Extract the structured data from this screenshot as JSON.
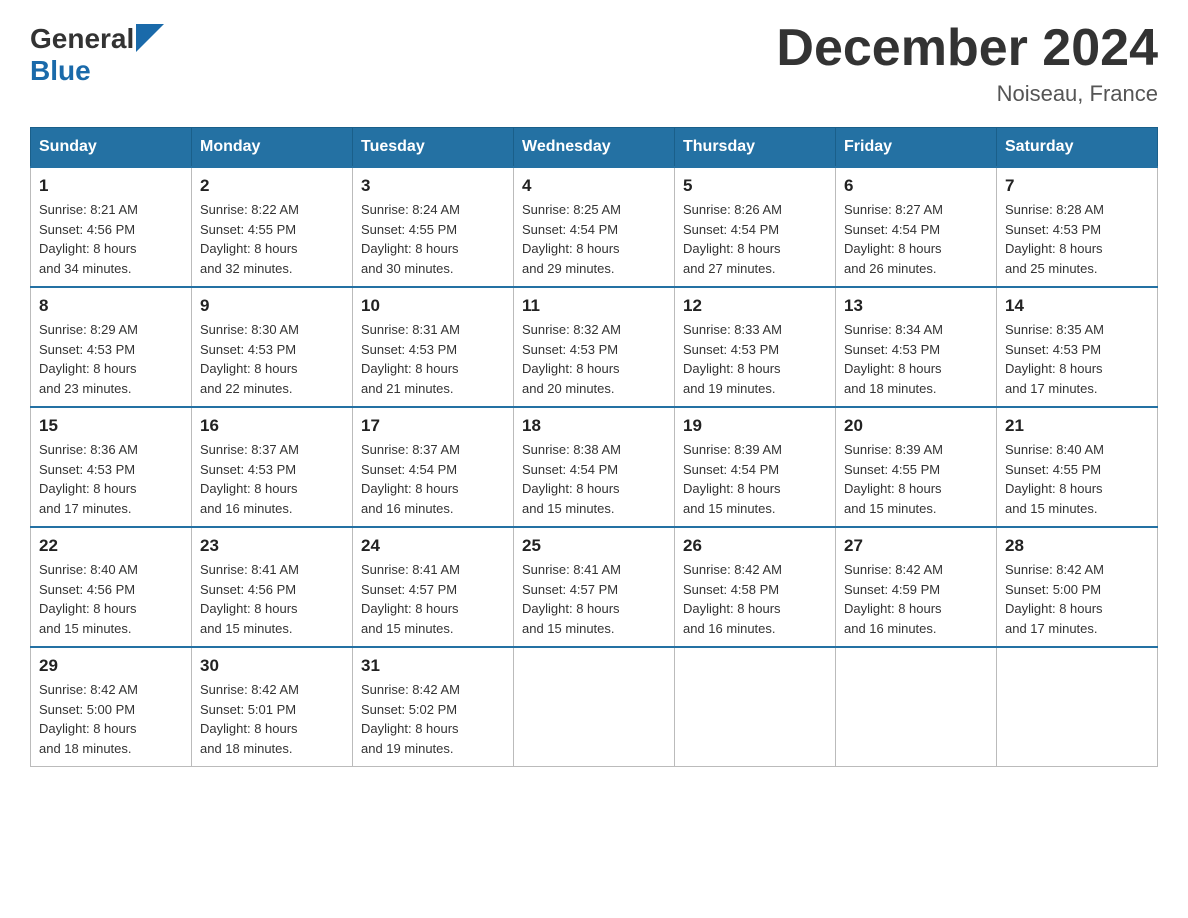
{
  "header": {
    "logo_general": "General",
    "logo_blue": "Blue",
    "title": "December 2024",
    "subtitle": "Noiseau, France"
  },
  "days_of_week": [
    "Sunday",
    "Monday",
    "Tuesday",
    "Wednesday",
    "Thursday",
    "Friday",
    "Saturday"
  ],
  "weeks": [
    [
      {
        "day": "1",
        "sunrise": "8:21 AM",
        "sunset": "4:56 PM",
        "daylight": "8 hours and 34 minutes."
      },
      {
        "day": "2",
        "sunrise": "8:22 AM",
        "sunset": "4:55 PM",
        "daylight": "8 hours and 32 minutes."
      },
      {
        "day": "3",
        "sunrise": "8:24 AM",
        "sunset": "4:55 PM",
        "daylight": "8 hours and 30 minutes."
      },
      {
        "day": "4",
        "sunrise": "8:25 AM",
        "sunset": "4:54 PM",
        "daylight": "8 hours and 29 minutes."
      },
      {
        "day": "5",
        "sunrise": "8:26 AM",
        "sunset": "4:54 PM",
        "daylight": "8 hours and 27 minutes."
      },
      {
        "day": "6",
        "sunrise": "8:27 AM",
        "sunset": "4:54 PM",
        "daylight": "8 hours and 26 minutes."
      },
      {
        "day": "7",
        "sunrise": "8:28 AM",
        "sunset": "4:53 PM",
        "daylight": "8 hours and 25 minutes."
      }
    ],
    [
      {
        "day": "8",
        "sunrise": "8:29 AM",
        "sunset": "4:53 PM",
        "daylight": "8 hours and 23 minutes."
      },
      {
        "day": "9",
        "sunrise": "8:30 AM",
        "sunset": "4:53 PM",
        "daylight": "8 hours and 22 minutes."
      },
      {
        "day": "10",
        "sunrise": "8:31 AM",
        "sunset": "4:53 PM",
        "daylight": "8 hours and 21 minutes."
      },
      {
        "day": "11",
        "sunrise": "8:32 AM",
        "sunset": "4:53 PM",
        "daylight": "8 hours and 20 minutes."
      },
      {
        "day": "12",
        "sunrise": "8:33 AM",
        "sunset": "4:53 PM",
        "daylight": "8 hours and 19 minutes."
      },
      {
        "day": "13",
        "sunrise": "8:34 AM",
        "sunset": "4:53 PM",
        "daylight": "8 hours and 18 minutes."
      },
      {
        "day": "14",
        "sunrise": "8:35 AM",
        "sunset": "4:53 PM",
        "daylight": "8 hours and 17 minutes."
      }
    ],
    [
      {
        "day": "15",
        "sunrise": "8:36 AM",
        "sunset": "4:53 PM",
        "daylight": "8 hours and 17 minutes."
      },
      {
        "day": "16",
        "sunrise": "8:37 AM",
        "sunset": "4:53 PM",
        "daylight": "8 hours and 16 minutes."
      },
      {
        "day": "17",
        "sunrise": "8:37 AM",
        "sunset": "4:54 PM",
        "daylight": "8 hours and 16 minutes."
      },
      {
        "day": "18",
        "sunrise": "8:38 AM",
        "sunset": "4:54 PM",
        "daylight": "8 hours and 15 minutes."
      },
      {
        "day": "19",
        "sunrise": "8:39 AM",
        "sunset": "4:54 PM",
        "daylight": "8 hours and 15 minutes."
      },
      {
        "day": "20",
        "sunrise": "8:39 AM",
        "sunset": "4:55 PM",
        "daylight": "8 hours and 15 minutes."
      },
      {
        "day": "21",
        "sunrise": "8:40 AM",
        "sunset": "4:55 PM",
        "daylight": "8 hours and 15 minutes."
      }
    ],
    [
      {
        "day": "22",
        "sunrise": "8:40 AM",
        "sunset": "4:56 PM",
        "daylight": "8 hours and 15 minutes."
      },
      {
        "day": "23",
        "sunrise": "8:41 AM",
        "sunset": "4:56 PM",
        "daylight": "8 hours and 15 minutes."
      },
      {
        "day": "24",
        "sunrise": "8:41 AM",
        "sunset": "4:57 PM",
        "daylight": "8 hours and 15 minutes."
      },
      {
        "day": "25",
        "sunrise": "8:41 AM",
        "sunset": "4:57 PM",
        "daylight": "8 hours and 15 minutes."
      },
      {
        "day": "26",
        "sunrise": "8:42 AM",
        "sunset": "4:58 PM",
        "daylight": "8 hours and 16 minutes."
      },
      {
        "day": "27",
        "sunrise": "8:42 AM",
        "sunset": "4:59 PM",
        "daylight": "8 hours and 16 minutes."
      },
      {
        "day": "28",
        "sunrise": "8:42 AM",
        "sunset": "5:00 PM",
        "daylight": "8 hours and 17 minutes."
      }
    ],
    [
      {
        "day": "29",
        "sunrise": "8:42 AM",
        "sunset": "5:00 PM",
        "daylight": "8 hours and 18 minutes."
      },
      {
        "day": "30",
        "sunrise": "8:42 AM",
        "sunset": "5:01 PM",
        "daylight": "8 hours and 18 minutes."
      },
      {
        "day": "31",
        "sunrise": "8:42 AM",
        "sunset": "5:02 PM",
        "daylight": "8 hours and 19 minutes."
      },
      null,
      null,
      null,
      null
    ]
  ],
  "labels": {
    "sunrise": "Sunrise:",
    "sunset": "Sunset:",
    "daylight": "Daylight:"
  }
}
